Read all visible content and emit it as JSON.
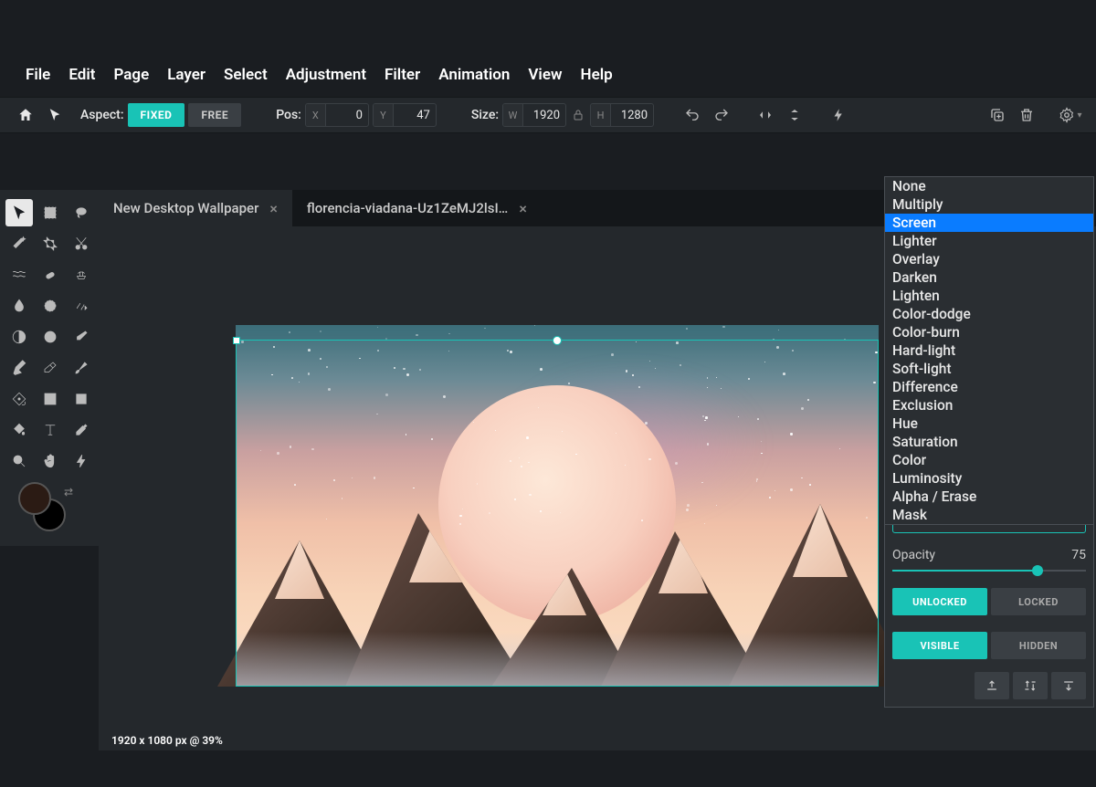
{
  "menubar": [
    "File",
    "Edit",
    "Page",
    "Layer",
    "Select",
    "Adjustment",
    "Filter",
    "Animation",
    "View",
    "Help"
  ],
  "optbar": {
    "aspect_label": "Aspect:",
    "fixed": "FIXED",
    "free": "FREE",
    "pos_label": "Pos:",
    "pos_x_prefix": "X",
    "pos_x": "0",
    "pos_y_prefix": "Y",
    "pos_y": "47",
    "size_label": "Size:",
    "size_w_prefix": "W",
    "size_w": "1920",
    "size_h_prefix": "H",
    "size_h": "1280"
  },
  "tabs": [
    {
      "label": "New Desktop Wallpaper",
      "active": true
    },
    {
      "label": "florencia-viadana-Uz1ZeMJ2lsI…",
      "active": false
    }
  ],
  "status": "1920 x 1080 px @ 39%",
  "blend_modes": [
    "None",
    "Multiply",
    "Screen",
    "Lighter",
    "Overlay",
    "Darken",
    "Lighten",
    "Color-dodge",
    "Color-burn",
    "Hard-light",
    "Soft-light",
    "Difference",
    "Exclusion",
    "Hue",
    "Saturation",
    "Color",
    "Luminosity",
    "Alpha / Erase",
    "Mask"
  ],
  "blend_selected": "Screen",
  "panel": {
    "opacity_label": "Opacity",
    "opacity_value": "75",
    "unlocked": "UNLOCKED",
    "locked": "LOCKED",
    "visible": "VISIBLE",
    "hidden": "HIDDEN"
  }
}
